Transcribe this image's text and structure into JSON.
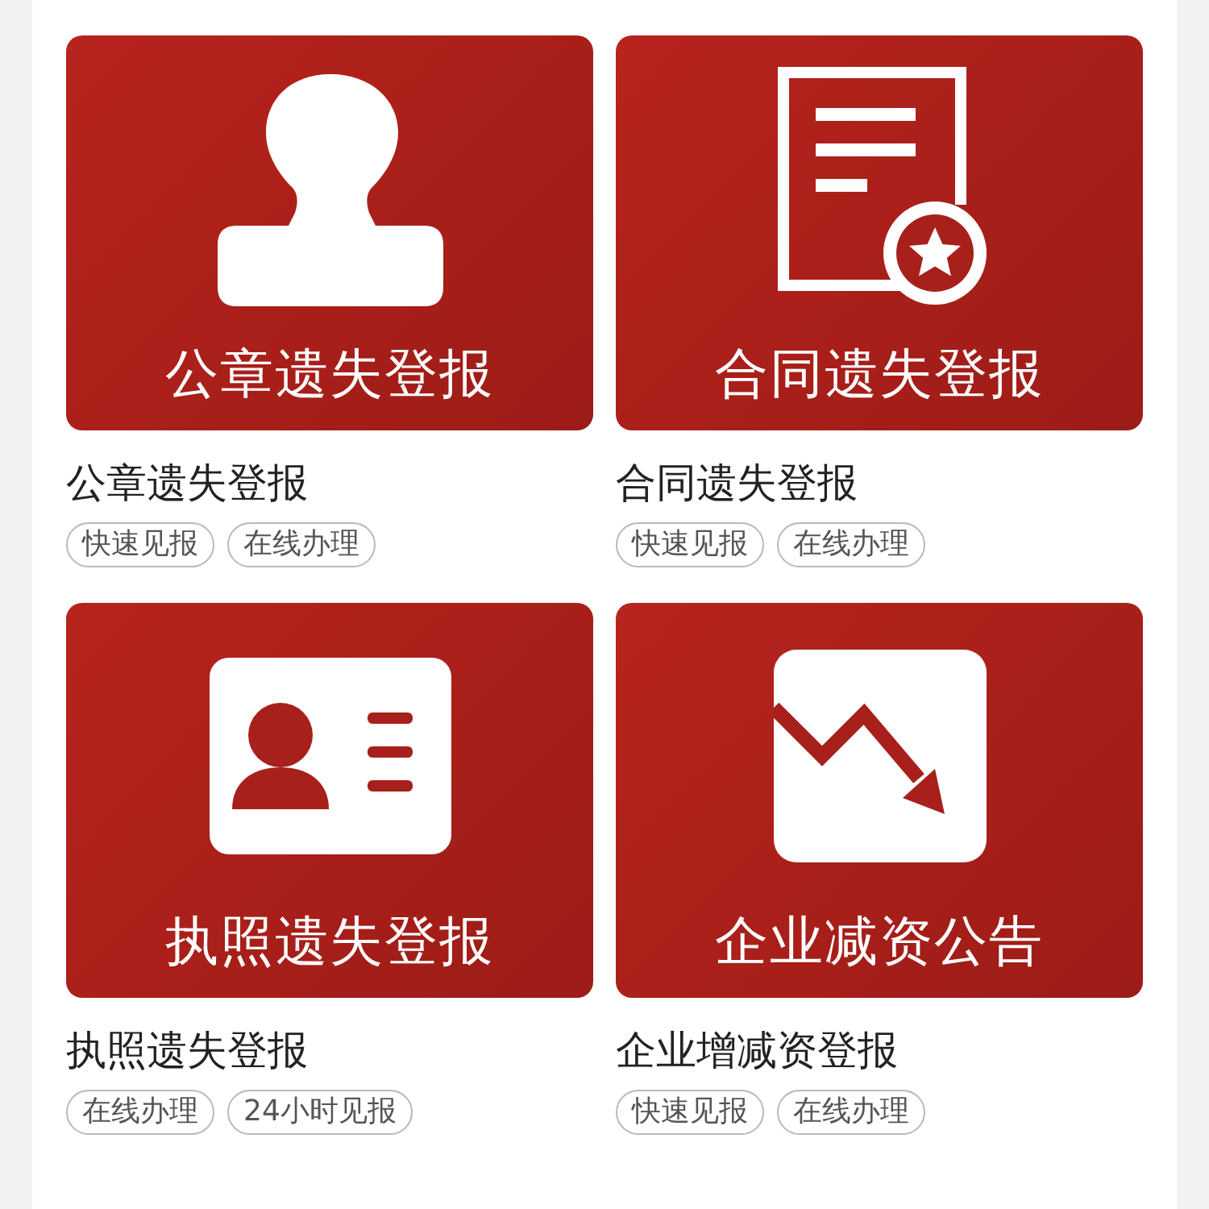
{
  "services": [
    {
      "banner_label": "公章遗失登报",
      "title": "公章遗失登报",
      "tags": [
        "快速见报",
        "在线办理"
      ]
    },
    {
      "banner_label": "合同遗失登报",
      "title": "合同遗失登报",
      "tags": [
        "快速见报",
        "在线办理"
      ]
    },
    {
      "banner_label": "执照遗失登报",
      "title": "执照遗失登报",
      "tags": [
        "在线办理",
        "24小时见报"
      ]
    },
    {
      "banner_label": "企业减资公告",
      "title": "企业增减资登报",
      "tags": [
        "快速见报",
        "在线办理"
      ]
    }
  ]
}
